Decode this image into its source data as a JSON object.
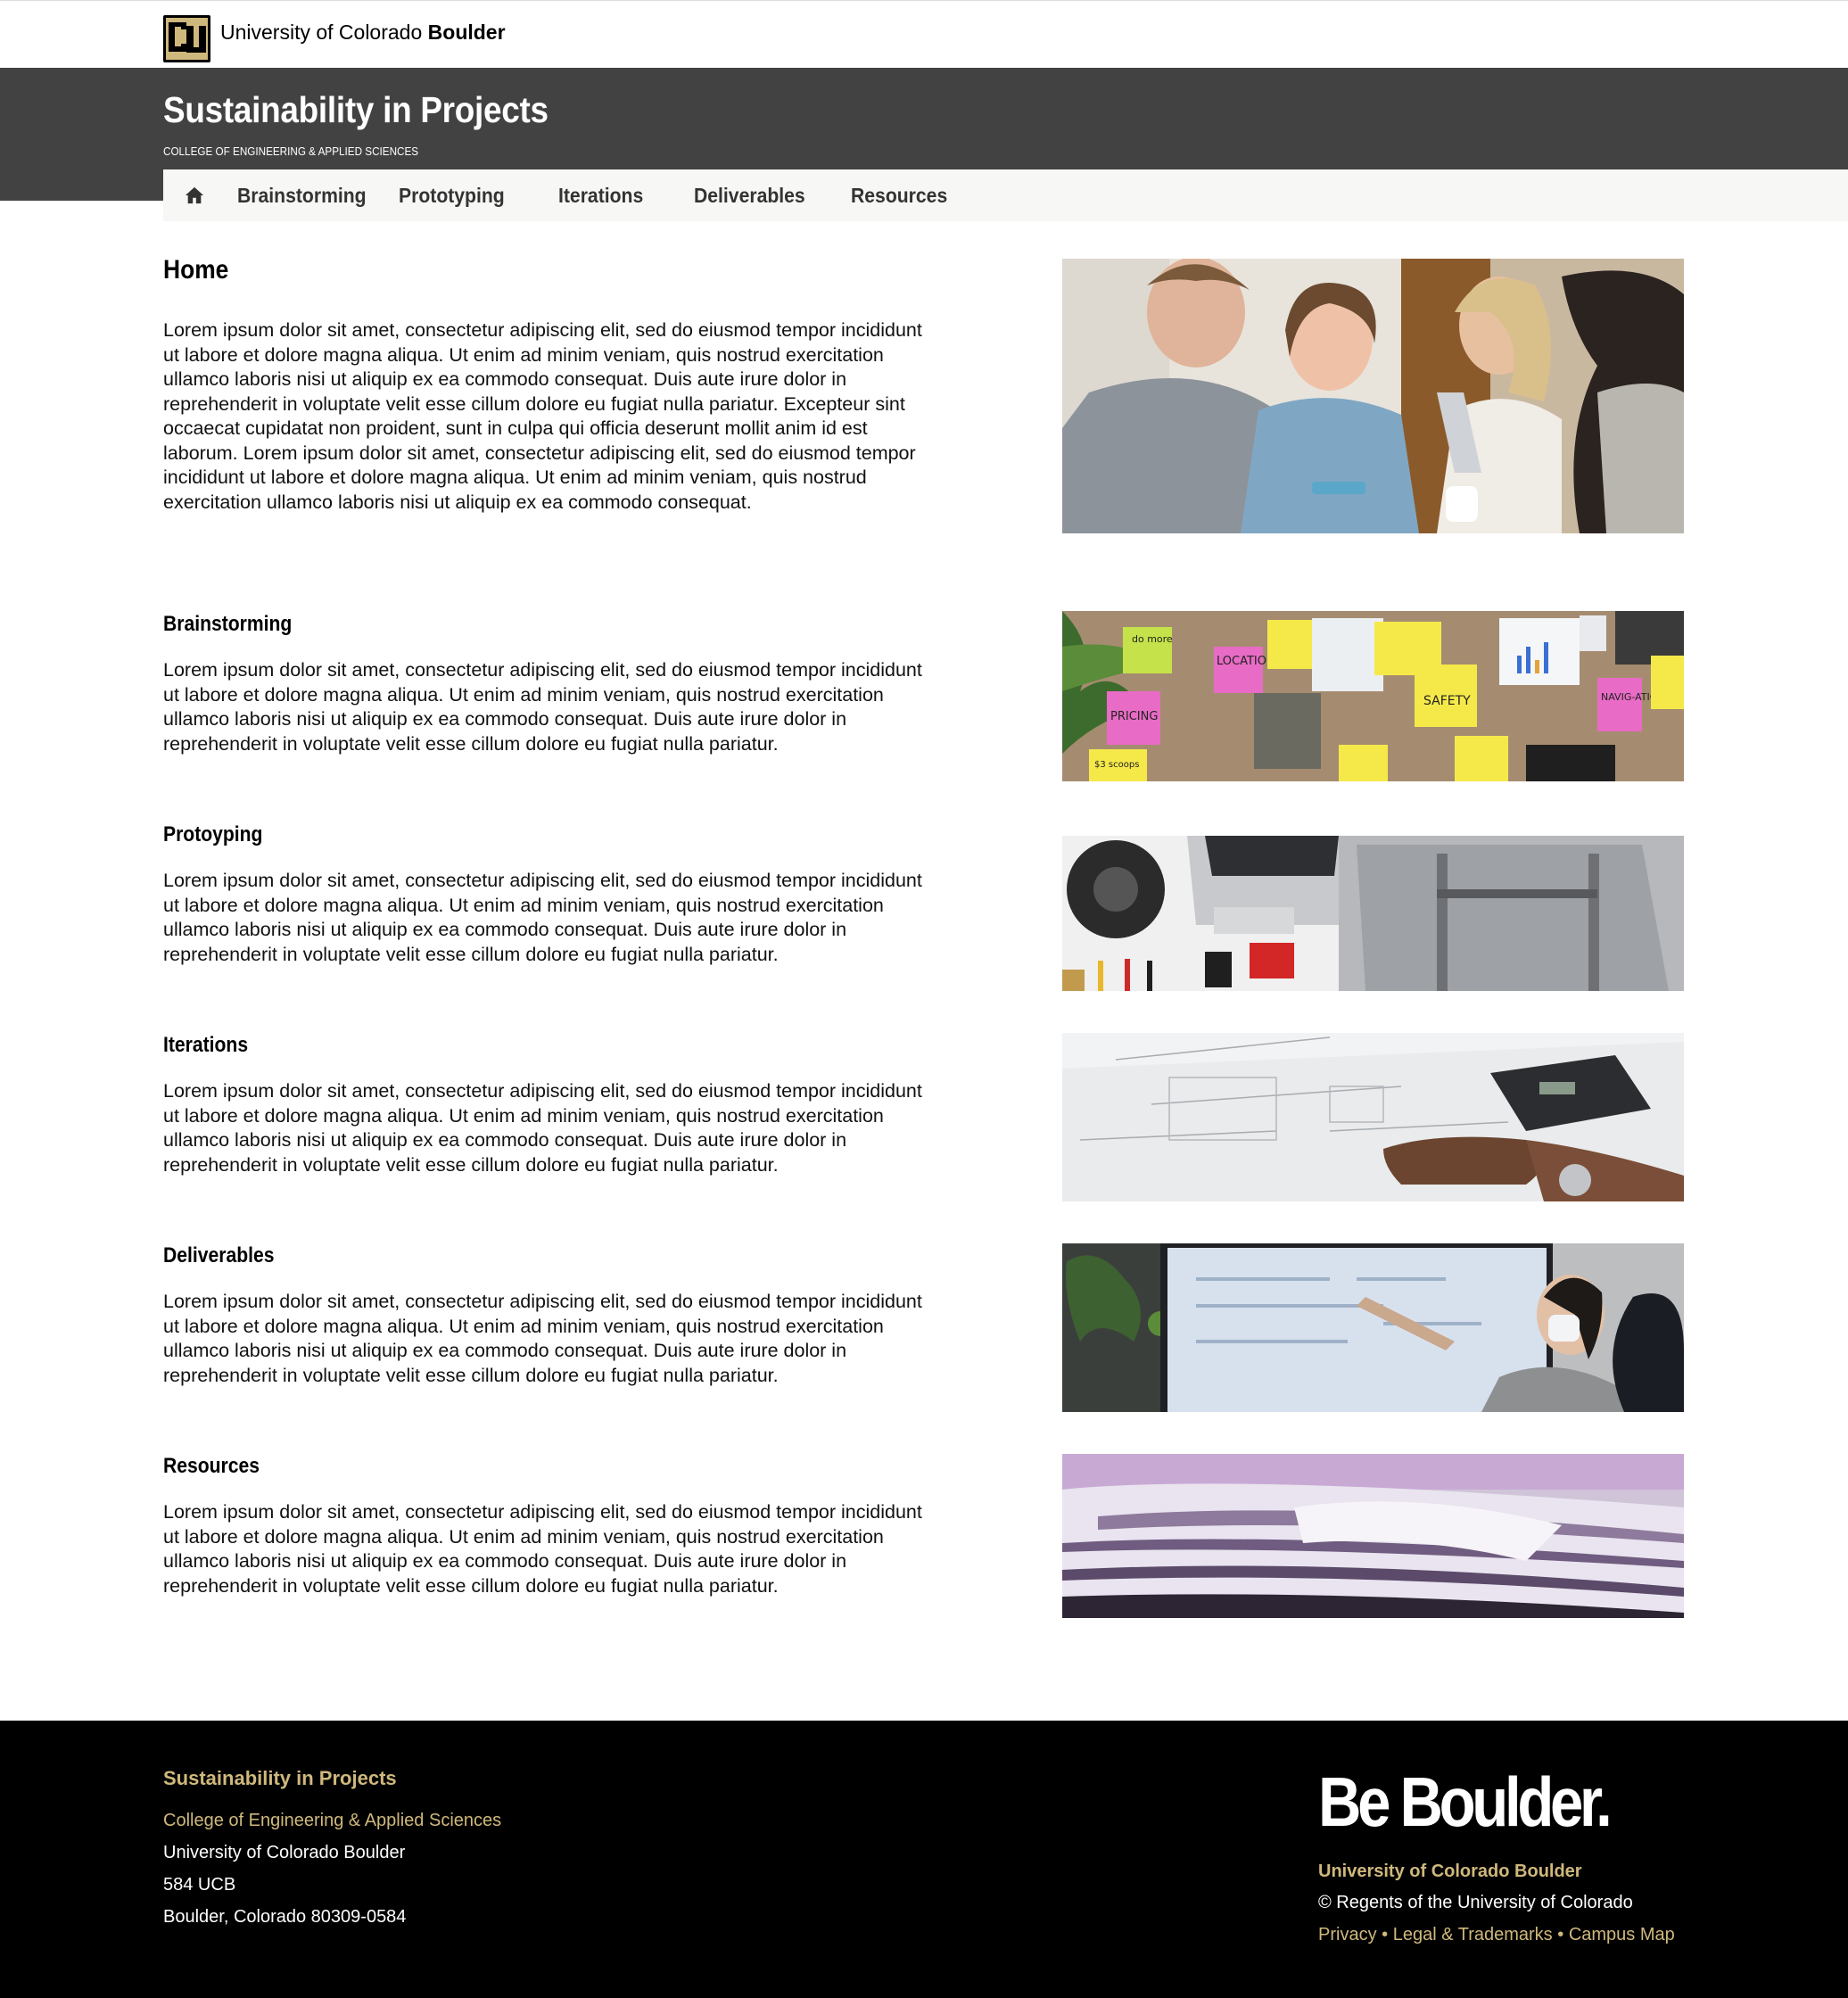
{
  "brand": {
    "logo_icon": "cu-logo-icon",
    "wordmark_regular": "University of Colorado ",
    "wordmark_bold": "Boulder"
  },
  "header": {
    "title": "Sustainability in Projects",
    "subtitle": "COLLEGE OF ENGINEERING & APPLIED SCIENCES"
  },
  "nav": {
    "home_icon": "home-icon",
    "items": [
      {
        "label": "Brainstorming"
      },
      {
        "label": "Prototyping"
      },
      {
        "label": "Iterations"
      },
      {
        "label": "Deliverables"
      },
      {
        "label": "Resources"
      }
    ]
  },
  "main": {
    "heading": "Home",
    "intro": "Lorem ipsum dolor sit amet, consectetur adipiscing elit, sed do eiusmod tempor incididunt ut labore et dolore magna aliqua. Ut enim ad minim veniam, quis nostrud exercitation ullamco laboris nisi ut aliquip ex ea commodo consequat. Duis aute irure dolor in reprehenderit in voluptate velit esse cillum dolore eu fugiat nulla pariatur. Excepteur sint occaecat cupidatat non proident, sunt in culpa qui officia deserunt mollit anim id est laborum. Lorem ipsum dolor sit amet, consectetur adipiscing elit, sed do eiusmod tempor incididunt ut labore et dolore magna aliqua. Ut enim ad minim veniam, quis nostrud exercitation ullamco laboris nisi ut aliquip ex ea commodo consequat.",
    "sections": [
      {
        "title": "Brainstorming",
        "body": "Lorem ipsum dolor sit amet, consectetur adipiscing elit, sed do eiusmod tempor incididunt ut labore et dolore magna aliqua. Ut enim ad minim veniam, quis nostrud exercitation ullamco laboris nisi ut aliquip ex ea commodo consequat. Duis aute irure dolor in reprehenderit in voluptate velit esse cillum dolore eu fugiat nulla pariatur."
      },
      {
        "title": "Protoyping",
        "body": "Lorem ipsum dolor sit amet, consectetur adipiscing elit, sed do eiusmod tempor incididunt ut labore et dolore magna aliqua. Ut enim ad minim veniam, quis nostrud exercitation ullamco laboris nisi ut aliquip ex ea commodo consequat. Duis aute irure dolor in reprehenderit in voluptate velit esse cillum dolore eu fugiat nulla pariatur."
      },
      {
        "title": "Iterations",
        "body": "Lorem ipsum dolor sit amet, consectetur adipiscing elit, sed do eiusmod tempor incididunt ut labore et dolore magna aliqua. Ut enim ad minim veniam, quis nostrud exercitation ullamco laboris nisi ut aliquip ex ea commodo consequat. Duis aute irure dolor in reprehenderit in voluptate velit esse cillum dolore eu fugiat nulla pariatur."
      },
      {
        "title": "Deliverables",
        "body": "Lorem ipsum dolor sit amet, consectetur adipiscing elit, sed do eiusmod tempor incididunt ut labore et dolore magna aliqua. Ut enim ad minim veniam, quis nostrud exercitation ullamco laboris nisi ut aliquip ex ea commodo consequat. Duis aute irure dolor in reprehenderit in voluptate velit esse cillum dolore eu fugiat nulla pariatur."
      },
      {
        "title": "Resources",
        "body": "Lorem ipsum dolor sit amet, consectetur adipiscing elit, sed do eiusmod tempor incididunt ut labore et dolore magna aliqua. Ut enim ad minim veniam, quis nostrud exercitation ullamco laboris nisi ut aliquip ex ea commodo consequat. Duis aute irure dolor in reprehenderit in voluptate velit esse cillum dolore eu fugiat nulla pariatur."
      }
    ],
    "sticky_notes": {
      "do_more": "do more",
      "location": "LOCATION",
      "pricing": "PRICING",
      "safety": "SAFETY",
      "navigation": "NAVIG-ATION",
      "price_tag": "$3 scoops"
    }
  },
  "footer": {
    "title": "Sustainability in Projects",
    "college_link": "College of Engineering & Applied Sciences",
    "university": "University of Colorado Boulder",
    "address1": "584 UCB",
    "address2": "Boulder, Colorado 80309-0584",
    "tagline": "Be Boulder.",
    "cu_name": "University of Colorado Boulder",
    "copyright": "© Regents of the University of Colorado",
    "links": [
      {
        "label": "Privacy"
      },
      {
        "label": "Legal & Trademarks"
      },
      {
        "label": "Campus Map"
      }
    ],
    "separator": " • "
  },
  "colors": {
    "header_bg": "#424242",
    "nav_bg": "#f7f7f5",
    "cu_gold": "#cfb87c",
    "footer_bg": "#000000"
  }
}
